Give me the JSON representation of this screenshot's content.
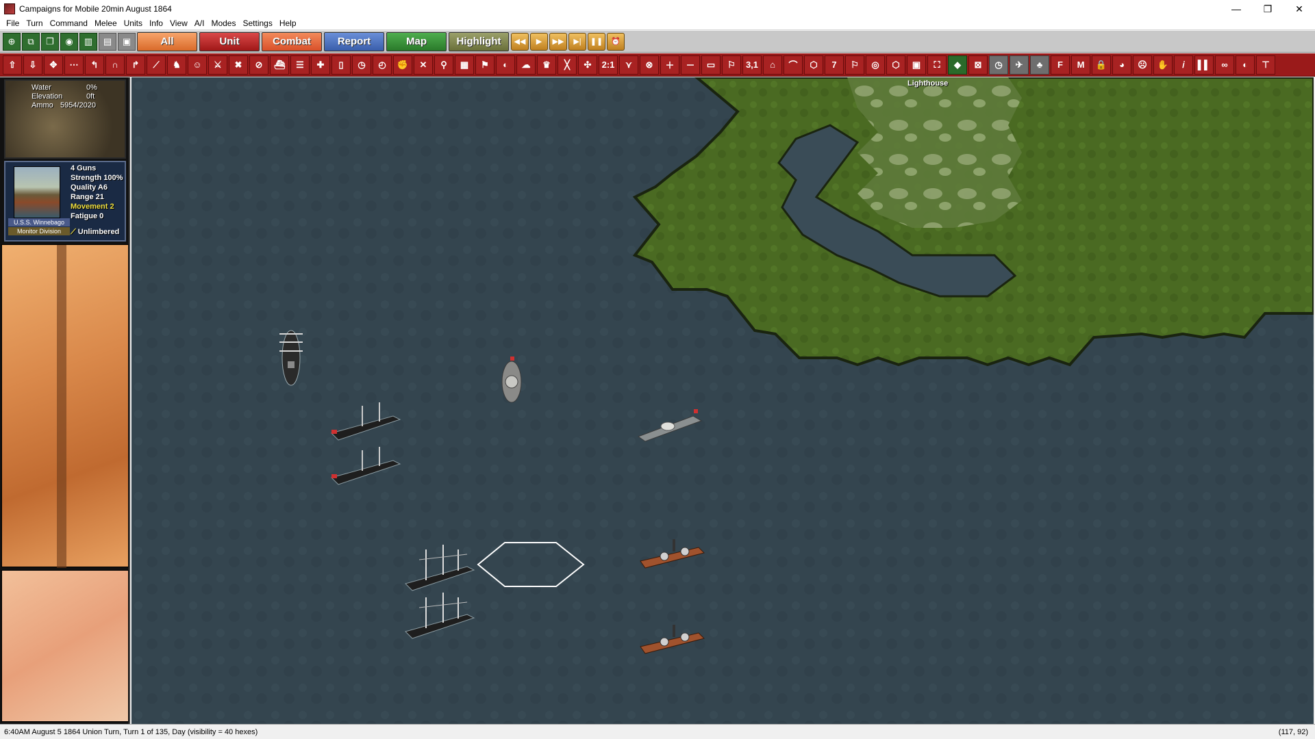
{
  "window": {
    "title": "Campaigns for Mobile 20min August 1864",
    "minimize": "—",
    "restore": "❐",
    "close": "✕"
  },
  "menu": [
    "File",
    "Turn",
    "Command",
    "Melee",
    "Units",
    "Info",
    "View",
    "A/I",
    "Modes",
    "Settings",
    "Help"
  ],
  "tabs": {
    "all": "All",
    "unit": "Unit",
    "combat": "Combat",
    "report": "Report",
    "map": "Map",
    "highlight": "Highlight"
  },
  "toolbar2_text": {
    "ratio": "2:1",
    "range": "3,1",
    "seven": "7",
    "f": "F",
    "m": "M"
  },
  "terrain": {
    "water_label": "Water",
    "water_value": "0%",
    "elevation_label": "Elevation",
    "elevation_value": "0ft",
    "ammo_label": "Ammo",
    "ammo_value": "5954/2020"
  },
  "unit": {
    "name": "U.S.S. Winnebago",
    "division": "Monitor Division",
    "guns": "4 Guns",
    "strength": "Strength 100%",
    "quality": "Quality A6",
    "range": "Range 21",
    "movement": "Movement 2",
    "fatigue": "Fatigue 0",
    "status": "Unlimbered"
  },
  "map": {
    "lighthouse_label": "Lighthouse"
  },
  "status": {
    "left": "6:40AM August 5 1864 Union Turn, Turn 1 of 135, Day (visibility = 40 hexes)",
    "right": "(117, 92)"
  }
}
